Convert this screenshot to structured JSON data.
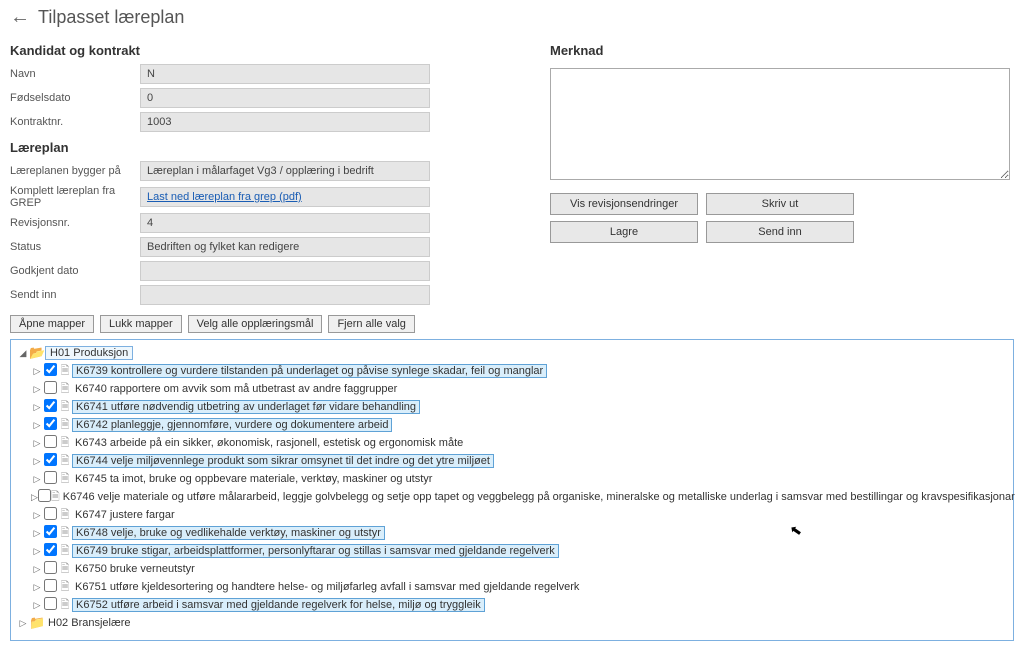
{
  "page": {
    "title": "Tilpasset læreplan"
  },
  "kandidat": {
    "heading": "Kandidat og kontrakt",
    "labels": {
      "navn": "Navn",
      "fodsel": "Fødselsdato",
      "kontrakt": "Kontraktnr."
    },
    "navn_prefix": "N",
    "navn_mask": "        ",
    "fodsel_prefix": "0",
    "fodsel_mask": "              ",
    "kontrakt": "1003"
  },
  "laereplan": {
    "heading": "Læreplan",
    "labels": {
      "bygger": "Læreplanen bygger på",
      "komplett": "Komplett læreplan fra GREP",
      "rev": "Revisjonsnr.",
      "status": "Status",
      "godkjent": "Godkjent dato",
      "sendt": "Sendt inn"
    },
    "bygger": "Læreplan i målarfaget Vg3 / opplæring i bedrift",
    "komplett_link": "Last ned læreplan fra grep (pdf)",
    "rev": "4",
    "status": "Bedriften og fylket kan redigere",
    "godkjent": "",
    "sendt": ""
  },
  "merknad": {
    "heading": "Merknad"
  },
  "buttons": {
    "vis": "Vis revisjonsendringer",
    "skriv": "Skriv ut",
    "lagre": "Lagre",
    "send": "Send inn",
    "apne": "Åpne mapper",
    "lukk": "Lukk mapper",
    "velg": "Velg alle opplæringsmål",
    "fjern": "Fjern alle valg"
  },
  "tree": {
    "h01": "H01 Produksjon",
    "h02": "H02 Bransjelære",
    "items": [
      {
        "code": "K6739",
        "text": "K6739 kontrollere og vurdere tilstanden på underlaget og påvise synlege skadar, feil og manglar",
        "checked": true,
        "sel": true
      },
      {
        "code": "K6740",
        "text": "K6740 rapportere om avvik som må utbetrast av andre faggrupper",
        "checked": false,
        "sel": false
      },
      {
        "code": "K6741",
        "text": "K6741 utføre nødvendig utbetring av underlaget før vidare behandling",
        "checked": true,
        "sel": true
      },
      {
        "code": "K6742",
        "text": "K6742 planleggje, gjennomføre, vurdere og dokumentere arbeid",
        "checked": true,
        "sel": true
      },
      {
        "code": "K6743",
        "text": "K6743 arbeide på ein sikker, økonomisk, rasjonell, estetisk og ergonomisk måte",
        "checked": false,
        "sel": false
      },
      {
        "code": "K6744",
        "text": "K6744 velje miljøvennlege produkt som sikrar omsynet til det indre og det ytre miljøet",
        "checked": true,
        "sel": true
      },
      {
        "code": "K6745",
        "text": "K6745 ta imot, bruke og oppbevare materiale, verktøy, maskiner og utstyr",
        "checked": false,
        "sel": false
      },
      {
        "code": "K6746",
        "text": "K6746 velje materiale og utføre målararbeid, leggje golvbelegg og setje opp tapet og veggbelegg på organiske, mineralske og metalliske underlag i samsvar med bestillingar og kravspesifikasjonar",
        "checked": false,
        "sel": false
      },
      {
        "code": "K6747",
        "text": "K6747 justere fargar",
        "checked": false,
        "sel": false
      },
      {
        "code": "K6748",
        "text": "K6748 velje, bruke og vedlikehalde verktøy, maskiner og utstyr",
        "checked": true,
        "sel": true
      },
      {
        "code": "K6749",
        "text": "K6749 bruke stigar, arbeidsplattformer, personlyftarar og stillas i samsvar med gjeldande regelverk",
        "checked": true,
        "sel": true
      },
      {
        "code": "K6750",
        "text": "K6750 bruke verneutstyr",
        "checked": false,
        "sel": false
      },
      {
        "code": "K6751",
        "text": "K6751 utføre kjeldesortering og handtere helse- og miljøfarleg avfall i samsvar med gjeldande regelverk",
        "checked": false,
        "sel": false
      },
      {
        "code": "K6752",
        "text": "K6752 utføre arbeid i samsvar med gjeldande regelverk for helse, miljø og tryggleik",
        "checked": false,
        "sel": true
      }
    ]
  }
}
